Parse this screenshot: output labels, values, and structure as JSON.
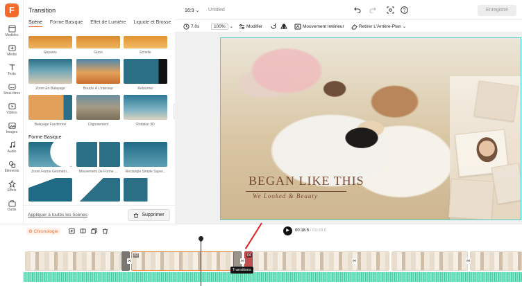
{
  "rail": {
    "logo": "F",
    "items": [
      {
        "label": "Modèles",
        "icon": "templates-icon"
      },
      {
        "label": "Média",
        "icon": "media-icon"
      },
      {
        "label": "Texte",
        "icon": "text-icon"
      },
      {
        "label": "Sous-titres",
        "icon": "subtitles-icon"
      },
      {
        "label": "Vidéos",
        "icon": "videos-icon"
      },
      {
        "label": "Images",
        "icon": "images-icon"
      },
      {
        "label": "Audio",
        "icon": "audio-icon"
      },
      {
        "label": "Éléments",
        "icon": "elements-icon"
      },
      {
        "label": "Effets",
        "icon": "effects-icon"
      },
      {
        "label": "Outils",
        "icon": "tools-icon"
      }
    ]
  },
  "panel": {
    "title": "Transition",
    "tabs": [
      "Scène",
      "Forme Basique",
      "Effet de Lumière",
      "Liquide et Brosse",
      "Co"
    ],
    "row0": [
      "Rayures",
      "Guori",
      "Échelle"
    ],
    "row1": [
      "Zoom En Balayage",
      "Boucle À L'intérieur",
      "Retourner"
    ],
    "row2": [
      "Balayage Fractionné",
      "Clignotement",
      "Rotation 3D"
    ],
    "section": "Forme Basique",
    "row3": [
      "Zoom Forme Géométri...",
      "Mouvement De Forme ...",
      "Rectangle Simple Super..."
    ],
    "apply_all": "Appliquer à toutes les Scènes",
    "delete": "Supprimer"
  },
  "topbar": {
    "ratio": "16:9",
    "title": "Untitled",
    "save": "Enregistré"
  },
  "toolbar": {
    "duration": "7.0s",
    "zoom": "100%",
    "edit": "Modifier",
    "motion": "Mouvement Intérieur",
    "remove_bg": "Retirer L'Arrière-Plan"
  },
  "canvas": {
    "headline": "BEGAN LIKE THIS",
    "subline": "We Looked & Beauty"
  },
  "timeline": {
    "chrono": "Chronologie",
    "time_current": "00:18.5",
    "time_total": "01:19.0",
    "clip_num_a": "03",
    "clip_num_b": "04",
    "tooltip": "Transitions"
  }
}
